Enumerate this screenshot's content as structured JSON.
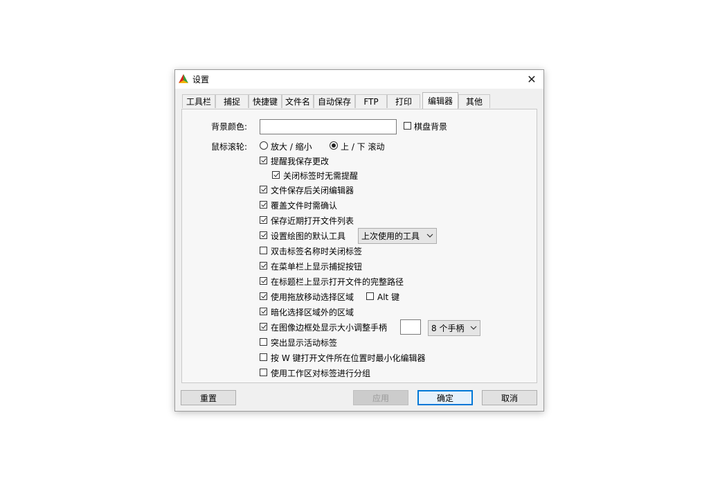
{
  "window": {
    "title": "设置",
    "close_glyph": "✕"
  },
  "tabs": [
    {
      "label": "工具栏"
    },
    {
      "label": "捕捉"
    },
    {
      "label": "快捷键"
    },
    {
      "label": "文件名"
    },
    {
      "label": "自动保存"
    },
    {
      "label": "FTP"
    },
    {
      "label": "打印"
    },
    {
      "label": "编辑器",
      "active": true
    },
    {
      "label": "其他"
    }
  ],
  "background": {
    "label": "背景颜色:",
    "checker_label": "棋盘背景",
    "checker_checked": false
  },
  "mouse_wheel": {
    "label": "鼠标滚轮:",
    "options": [
      {
        "label": "放大 / 缩小",
        "selected": false
      },
      {
        "label": "上 / 下 滚动",
        "selected": true
      }
    ]
  },
  "options": [
    {
      "label": "提醒我保存更改",
      "checked": true
    },
    {
      "label": "关闭标签时无需提醒",
      "checked": true
    },
    {
      "label": "文件保存后关闭编辑器",
      "checked": true
    },
    {
      "label": "覆盖文件时需确认",
      "checked": true
    },
    {
      "label": "保存近期打开文件列表",
      "checked": true
    },
    {
      "label": "设置绘图的默认工具",
      "checked": true
    },
    {
      "label": "双击标签名称时关闭标签",
      "checked": false
    },
    {
      "label": "在菜单栏上显示捕捉按钮",
      "checked": true
    },
    {
      "label": "在标题栏上显示打开文件的完整路径",
      "checked": true
    },
    {
      "label": "使用拖放移动选择区域",
      "checked": true
    },
    {
      "label": "暗化选择区域外的区域",
      "checked": true
    },
    {
      "label": "在图像边框处显示大小调整手柄",
      "checked": true
    },
    {
      "label": "突出显示活动标签",
      "checked": false
    },
    {
      "label": "按 W 键打开文件所在位置时最小化编辑器",
      "checked": false
    },
    {
      "label": "使用工作区对标签进行分组",
      "checked": false
    }
  ],
  "default_tool_combo": {
    "value": "上次使用的工具"
  },
  "alt_key": {
    "label": "Alt 键",
    "checked": false
  },
  "handles_combo": {
    "value": "8 个手柄"
  },
  "buttons": {
    "reset": "重置",
    "apply": "应用",
    "ok": "确定",
    "cancel": "取消"
  },
  "colors": {
    "accent": "#0078d7",
    "icon_red": "#d9271c",
    "icon_green": "#3a9d3a",
    "icon_yellow": "#f2b400"
  }
}
